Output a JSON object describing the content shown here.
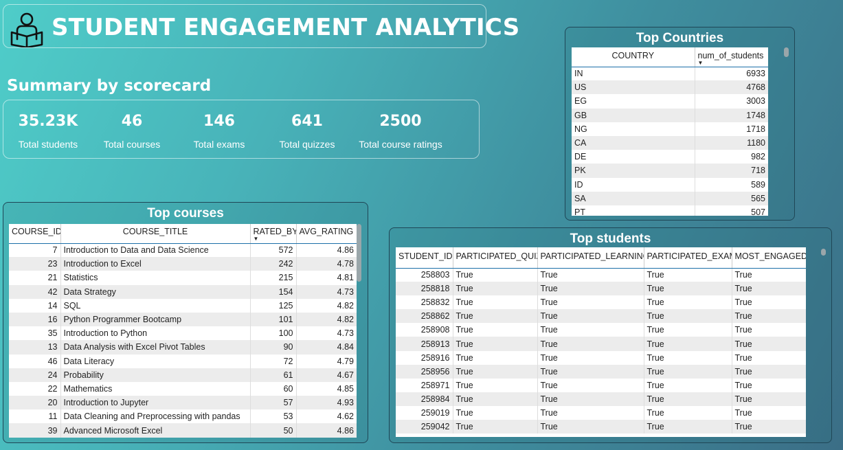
{
  "header": {
    "title": "STUDENT ENGAGEMENT ANALYTICS",
    "icon": "student-reading-icon"
  },
  "summary": {
    "title": "Summary by scorecard",
    "cards": [
      {
        "value": "35.23K",
        "label": "Total students"
      },
      {
        "value": "46",
        "label": "Total courses"
      },
      {
        "value": "146",
        "label": "Total exams"
      },
      {
        "value": "641",
        "label": "Total quizzes"
      },
      {
        "value": "2500",
        "label": "Total course ratings"
      }
    ]
  },
  "top_countries": {
    "title": "Top Countries",
    "columns": [
      "COUNTRY",
      "num_of_students"
    ],
    "sorted_column": "num_of_students",
    "rows": [
      [
        "IN",
        "6933"
      ],
      [
        "US",
        "4768"
      ],
      [
        "EG",
        "3003"
      ],
      [
        "GB",
        "1748"
      ],
      [
        "NG",
        "1718"
      ],
      [
        "CA",
        "1180"
      ],
      [
        "DE",
        "982"
      ],
      [
        "PK",
        "718"
      ],
      [
        "ID",
        "589"
      ],
      [
        "SA",
        "565"
      ],
      [
        "PT",
        "507"
      ]
    ]
  },
  "top_courses": {
    "title": "Top courses",
    "columns": [
      "COURSE_ID",
      "COURSE_TITLE",
      "RATED_BY",
      "AVG_RATING"
    ],
    "sorted_column": "RATED_BY",
    "rows": [
      [
        "7",
        "Introduction to Data and Data Science",
        "572",
        "4.86"
      ],
      [
        "23",
        "Introduction to Excel",
        "242",
        "4.78"
      ],
      [
        "21",
        "Statistics",
        "215",
        "4.81"
      ],
      [
        "42",
        "Data Strategy",
        "154",
        "4.73"
      ],
      [
        "14",
        "SQL",
        "125",
        "4.82"
      ],
      [
        "16",
        "Python Programmer Bootcamp",
        "101",
        "4.82"
      ],
      [
        "35",
        "Introduction to Python",
        "100",
        "4.73"
      ],
      [
        "13",
        "Data Analysis with Excel Pivot Tables",
        "90",
        "4.84"
      ],
      [
        "46",
        "Data Literacy",
        "72",
        "4.79"
      ],
      [
        "24",
        "Probability",
        "61",
        "4.67"
      ],
      [
        "22",
        "Mathematics",
        "60",
        "4.85"
      ],
      [
        "20",
        "Introduction to Jupyter",
        "57",
        "4.93"
      ],
      [
        "11",
        "Data Cleaning and Preprocessing with pandas",
        "53",
        "4.62"
      ],
      [
        "39",
        "Advanced Microsoft Excel",
        "50",
        "4.86"
      ]
    ]
  },
  "top_students": {
    "title": "Top students",
    "columns": [
      "STUDENT_ID",
      "PARTICIPATED_QUIZ",
      "PARTICIPATED_LEARNING",
      "PARTICIPATED_EXAM",
      "MOST_ENGAGED"
    ],
    "rows": [
      [
        "258803",
        "True",
        "True",
        "True",
        "True"
      ],
      [
        "258818",
        "True",
        "True",
        "True",
        "True"
      ],
      [
        "258832",
        "True",
        "True",
        "True",
        "True"
      ],
      [
        "258862",
        "True",
        "True",
        "True",
        "True"
      ],
      [
        "258908",
        "True",
        "True",
        "True",
        "True"
      ],
      [
        "258913",
        "True",
        "True",
        "True",
        "True"
      ],
      [
        "258916",
        "True",
        "True",
        "True",
        "True"
      ],
      [
        "258956",
        "True",
        "True",
        "True",
        "True"
      ],
      [
        "258971",
        "True",
        "True",
        "True",
        "True"
      ],
      [
        "258984",
        "True",
        "True",
        "True",
        "True"
      ],
      [
        "259019",
        "True",
        "True",
        "True",
        "True"
      ],
      [
        "259042",
        "True",
        "True",
        "True",
        "True"
      ]
    ]
  }
}
